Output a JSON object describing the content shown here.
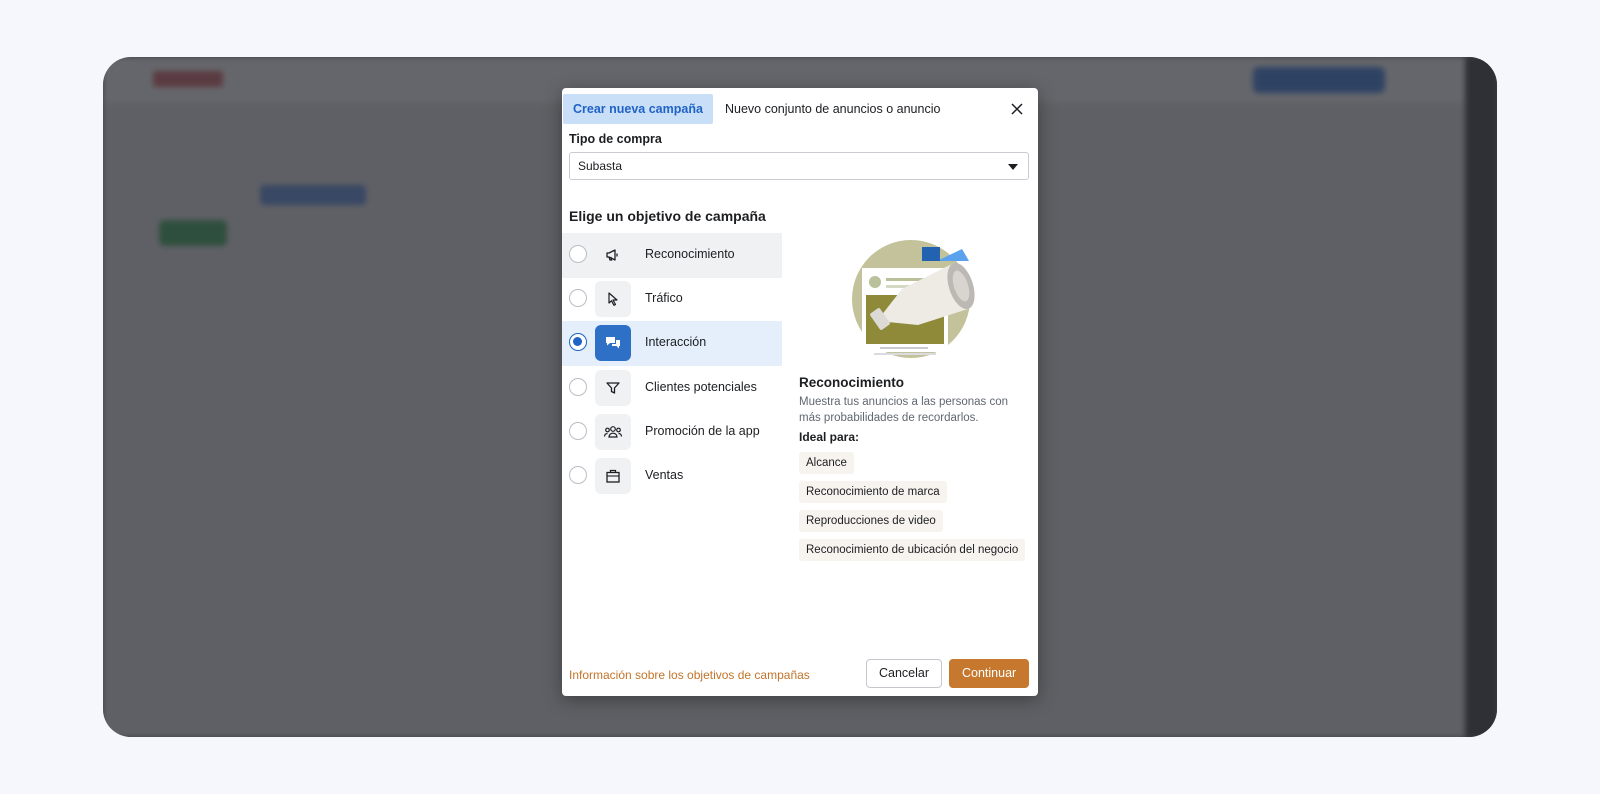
{
  "dialog": {
    "tabs": [
      "Crear nueva campaña",
      "Nuevo conjunto de anuncios o anuncio"
    ],
    "buying_type": {
      "label": "Tipo de compra",
      "value": "Subasta"
    },
    "objective_heading": "Elige un objetivo de campaña",
    "objectives": [
      {
        "label": "Reconocimiento",
        "icon": "megaphone-icon",
        "selected": false
      },
      {
        "label": "Tráfico",
        "icon": "cursor-icon",
        "selected": false
      },
      {
        "label": "Interacción",
        "icon": "chat-bubbles-icon",
        "selected": true
      },
      {
        "label": "Clientes potenciales",
        "icon": "filter-icon",
        "selected": false
      },
      {
        "label": "Promoción de la app",
        "icon": "people-icon",
        "selected": false
      },
      {
        "label": "Ventas",
        "icon": "shopping-bag-icon",
        "selected": false
      }
    ],
    "detail": {
      "title": "Reconocimiento",
      "description": "Muestra tus anuncios a las personas con más probabilidades de recordarlos.",
      "ideal_label": "Ideal para:",
      "chips": [
        "Alcance",
        "Reconocimiento de marca",
        "Reproducciones de video",
        "Reconocimiento de ubicación del negocio"
      ]
    },
    "footer": {
      "info_link": "Información sobre los objetivos de campañas",
      "cancel": "Cancelar",
      "continue": "Continuar"
    }
  },
  "colors": {
    "accent_blue": "#1f63c7",
    "selected_icon_bg": "#2f70c7",
    "continue_orange": "#c7782f",
    "link_orange": "#c2752a"
  }
}
